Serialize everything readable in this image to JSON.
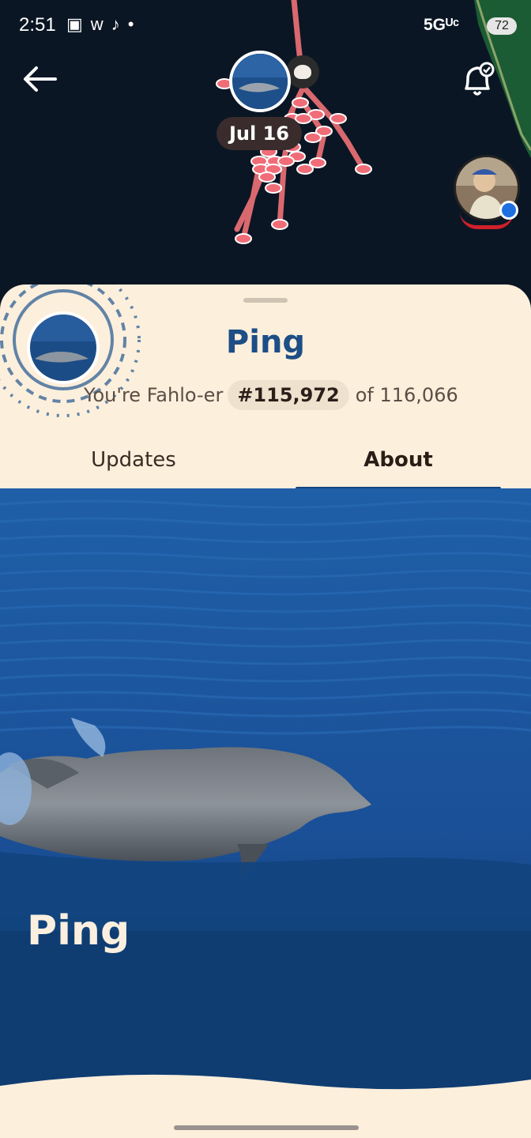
{
  "status_bar": {
    "time": "2:51",
    "app_icons": [
      "screen-record-icon",
      "w",
      "tiktok-icon",
      "•"
    ],
    "network": "5Gᵁᶜ",
    "battery": "72"
  },
  "map": {
    "date_label": "Jul 16",
    "route_color": "#e06c72",
    "land_color": "#1f6a3a"
  },
  "profile": {
    "name": "Ping",
    "rank_prefix": "You're Fahlo-er",
    "rank": "#115,972",
    "rank_suffix": "of 116,066"
  },
  "tabs": [
    {
      "label": "Updates",
      "active": false
    },
    {
      "label": "About",
      "active": true
    }
  ],
  "hero": {
    "title": "Ping"
  },
  "colors": {
    "sheet_bg": "#fcefdc",
    "accent": "#14477f",
    "name_color": "#1d4e86",
    "ocean": "#0f3a6f"
  }
}
